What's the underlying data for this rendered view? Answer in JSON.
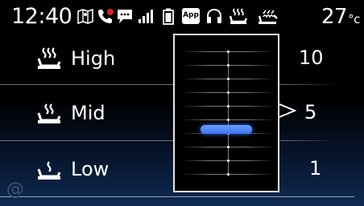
{
  "status_bar": {
    "time": "12:40",
    "temperature": "27",
    "temperature_unit": "°c",
    "app_badge": "App",
    "icons": [
      "navigation-map-icon",
      "missed-call-icon",
      "message-icon",
      "signal-strength-icon",
      "battery-icon",
      "app-icon",
      "headset-icon",
      "seat-heater-icon",
      "seat-cooler-icon"
    ],
    "missed_call_color": "#e0202a"
  },
  "levels": [
    {
      "label": "High",
      "value": "10",
      "icon": "seat-heat-high-icon"
    },
    {
      "label": "Mid",
      "value": "5",
      "icon": "seat-heat-mid-icon"
    },
    {
      "label": "Low",
      "value": "1",
      "icon": "seat-heat-low-icon"
    }
  ],
  "slider": {
    "min": 1,
    "max": 10,
    "current": 5,
    "thumb_color": "#3d74f0"
  },
  "footer_glyph": "@"
}
